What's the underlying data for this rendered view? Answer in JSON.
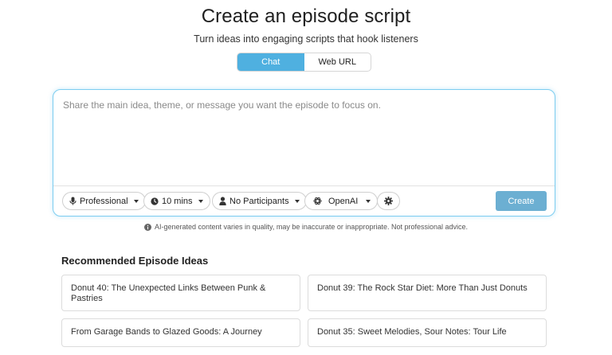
{
  "header": {
    "title": "Create an episode script",
    "subtitle": "Turn ideas into engaging scripts that hook listeners"
  },
  "mode_tabs": [
    {
      "label": "Chat",
      "active": true
    },
    {
      "label": "Web URL",
      "active": false
    }
  ],
  "composer": {
    "placeholder": "Share the main idea, theme, or message you want the episode to focus on.",
    "value": "",
    "options": {
      "tone": "Professional",
      "duration": "10 mins",
      "participants": "No Participants",
      "model": "OpenAI"
    },
    "create_label": "Create"
  },
  "disclaimer": "AI-generated content varies in quality, may be inaccurate or inappropriate. Not professional advice.",
  "recommended": {
    "title": "Recommended Episode Ideas",
    "ideas": [
      "Donut 40: The Unexpected Links Between Punk & Pastries",
      "Donut 39: The Rock Star Diet: More Than Just Donuts",
      "From Garage Bands to Glazed Goods: A Journey",
      "Donut 35: Sweet Melodies, Sour Notes: Tour Life"
    ]
  },
  "colors": {
    "accent": "#4fb0e0",
    "create_button": "#6cafd2",
    "composer_border": "#7dcdf0"
  },
  "icons": {
    "tone": "microphone-icon",
    "duration": "clock-icon",
    "participants": "person-icon",
    "model": "openai-icon",
    "settings": "gear-icon",
    "disclaimer": "info-icon"
  }
}
